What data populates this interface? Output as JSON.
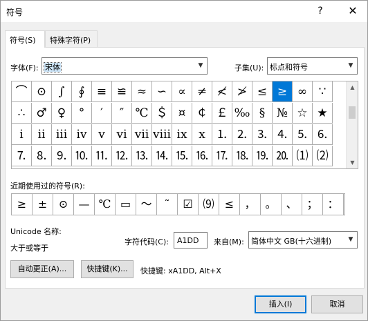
{
  "titlebar": {
    "title": "符号",
    "help": "?",
    "close": "✕"
  },
  "tabs": [
    {
      "label": "符号(S)"
    },
    {
      "label": "特殊字符(P)"
    }
  ],
  "font": {
    "label": "字体(F):",
    "value": "宋体"
  },
  "subset": {
    "label": "子集(U):",
    "value": "标点和符号"
  },
  "symbols": [
    [
      "⌒",
      "⊙",
      "∫",
      "∮",
      "≡",
      "≌",
      "≈",
      "∽",
      "∝",
      "≠",
      "≮",
      "≯",
      "≤",
      "≥",
      "∞",
      "∵"
    ],
    [
      "∴",
      "♂",
      "♀",
      "°",
      "′",
      "″",
      "℃",
      "＄",
      "¤",
      "￠",
      "￡",
      "‰",
      "§",
      "№",
      "☆",
      "★"
    ],
    [
      "ⅰ",
      "ⅱ",
      "ⅲ",
      "ⅳ",
      "ⅴ",
      "ⅵ",
      "ⅶ",
      "ⅷ",
      "ⅸ",
      "ⅹ",
      "⒈",
      "⒉",
      "⒊",
      "⒋",
      "⒌",
      "⒍"
    ],
    [
      "⒎",
      "⒏",
      "⒐",
      "⒑",
      "⒒",
      "⒓",
      "⒔",
      "⒕",
      "⒖",
      "⒗",
      "⒘",
      "⒙",
      "⒚",
      "⒛",
      "⑴",
      "⑵"
    ]
  ],
  "selected_symbol": "≥",
  "recent": {
    "label": "近期使用过的符号(R):",
    "items": [
      "≥",
      "±",
      "⊙",
      "—",
      "℃",
      "▭",
      "～",
      "˜",
      "☑",
      "⑼",
      "≤",
      "，",
      "。",
      "、",
      "；",
      "："
    ]
  },
  "unicode": {
    "label": "Unicode 名称:",
    "name": "大于或等于"
  },
  "char_code": {
    "label": "字符代码(C):",
    "value": "A1DD"
  },
  "from": {
    "label": "来自(M):",
    "value": "简体中文 GB(十六进制)"
  },
  "autocorrect_label": "自动更正(A)...",
  "shortcut_key_label": "快捷键(K)...",
  "shortcut_text": "快捷键: xA1DD, Alt+X",
  "insert_label": "插入(I)",
  "cancel_label": "取消"
}
